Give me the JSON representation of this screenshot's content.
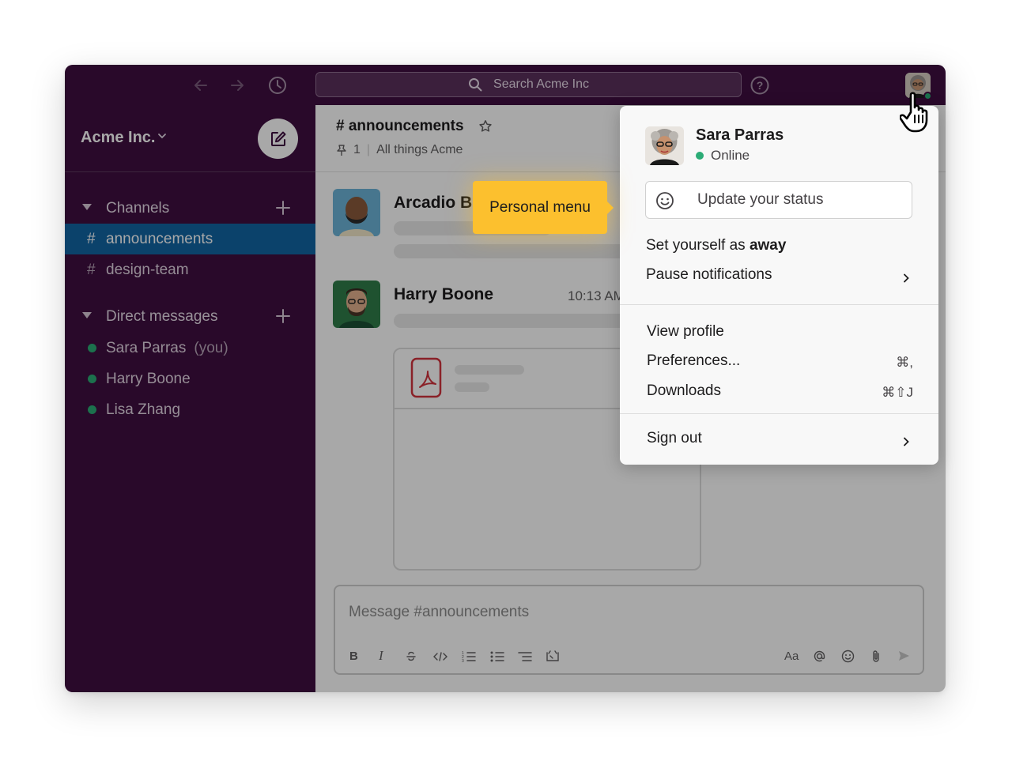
{
  "window": {
    "search_placeholder": "Search Acme Inc",
    "nav_icons": [
      "arrow-left-icon",
      "arrow-right-icon",
      "history-clock-icon",
      "help-icon"
    ]
  },
  "sidebar": {
    "workspace_name": "Acme Inc.",
    "channels_label": "Channels",
    "channels": [
      {
        "label": "announcements",
        "active": true
      },
      {
        "label": "design-team",
        "active": false
      }
    ],
    "dms_label": "Direct messages",
    "dms": [
      {
        "label": "Sara Parras",
        "suffix": "(you)"
      },
      {
        "label": "Harry Boone",
        "suffix": ""
      },
      {
        "label": "Lisa Zhang",
        "suffix": ""
      }
    ]
  },
  "channel": {
    "name": "# announcements",
    "pin_count": "1",
    "topic": "All things Acme"
  },
  "messages": [
    {
      "author": "Arcadio B",
      "time": ""
    },
    {
      "author": "Harry Boone",
      "time": "10:13 AM"
    }
  ],
  "composer": {
    "placeholder": "Message #announcements",
    "format_bold": "B",
    "format_italic": "I",
    "format_aa": "Aa"
  },
  "tooltip": {
    "text": "Personal menu"
  },
  "menu": {
    "user_name": "Sara Parras",
    "presence": "Online",
    "status_placeholder": "Update your status",
    "away_prefix": "Set yourself as ",
    "away_bold": "away",
    "pause_notifications": "Pause notifications",
    "view_profile": "View profile",
    "preferences": "Preferences...",
    "preferences_shortcut": "⌘,",
    "downloads": "Downloads",
    "downloads_shortcut": "⌘⇧J",
    "sign_out": "Sign out"
  },
  "colors": {
    "aubergine": "#3f0e40",
    "active_channel": "#1164a3",
    "presence_green": "#2bac76",
    "tooltip_yellow": "#fcc02e"
  }
}
